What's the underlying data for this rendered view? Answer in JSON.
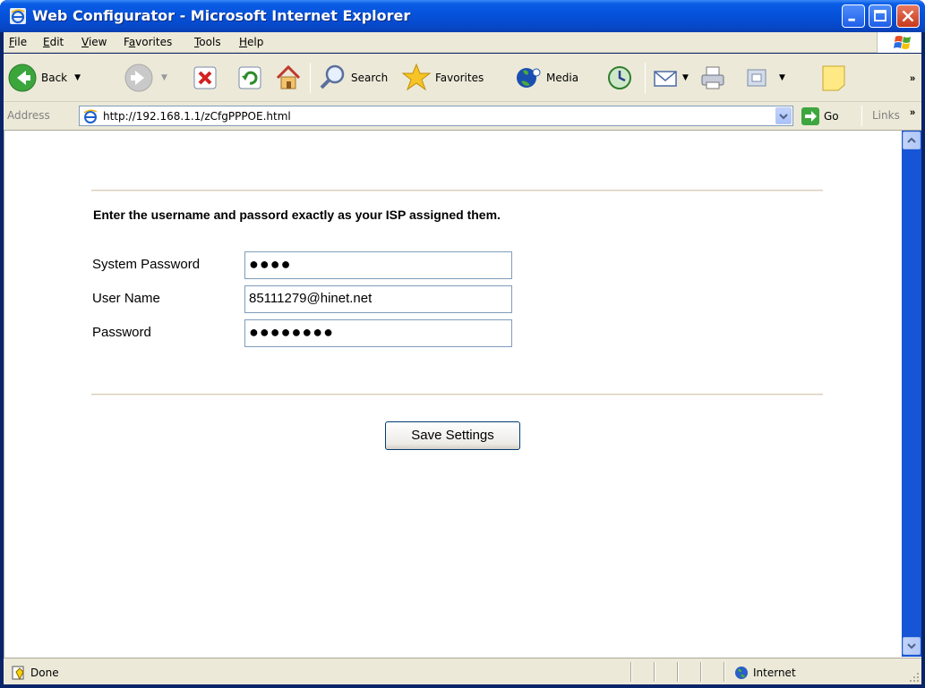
{
  "window": {
    "title": "Web Configurator - Microsoft Internet Explorer"
  },
  "menu": {
    "items": [
      {
        "label": "File",
        "accel": "F",
        "rest": "ile"
      },
      {
        "label": "Edit",
        "accel": "E",
        "rest": "dit"
      },
      {
        "label": "View",
        "accel": "V",
        "rest": "iew"
      },
      {
        "label": "Favorites",
        "pre": "F",
        "accel": "a",
        "rest": "vorites"
      },
      {
        "label": "Tools",
        "accel": "T",
        "rest": "ools"
      },
      {
        "label": "Help",
        "accel": "H",
        "rest": "elp"
      }
    ]
  },
  "toolbar": {
    "back_label": "Back",
    "search_label": "Search",
    "favorites_label": "Favorites",
    "media_label": "Media"
  },
  "address": {
    "label": "Address",
    "url": "http://192.168.1.1/zCfgPPPOE.html",
    "go_label": "Go",
    "links_label": "Links"
  },
  "form": {
    "instruction": "Enter the username and passord exactly as your ISP assigned them.",
    "fields": [
      {
        "label": "System Password",
        "value": "●●●●",
        "type": "password"
      },
      {
        "label": "User Name",
        "value": "85111279@hinet.net",
        "type": "text"
      },
      {
        "label": "Password",
        "value": "●●●●●●●●",
        "type": "password"
      }
    ],
    "save_label": "Save Settings"
  },
  "status": {
    "text": "Done",
    "zone": "Internet"
  },
  "colors": {
    "titlebar": "#0551d9",
    "chrome": "#ece9d8",
    "scrollbar": "#1555d6",
    "divider": "#d8ceb8"
  }
}
